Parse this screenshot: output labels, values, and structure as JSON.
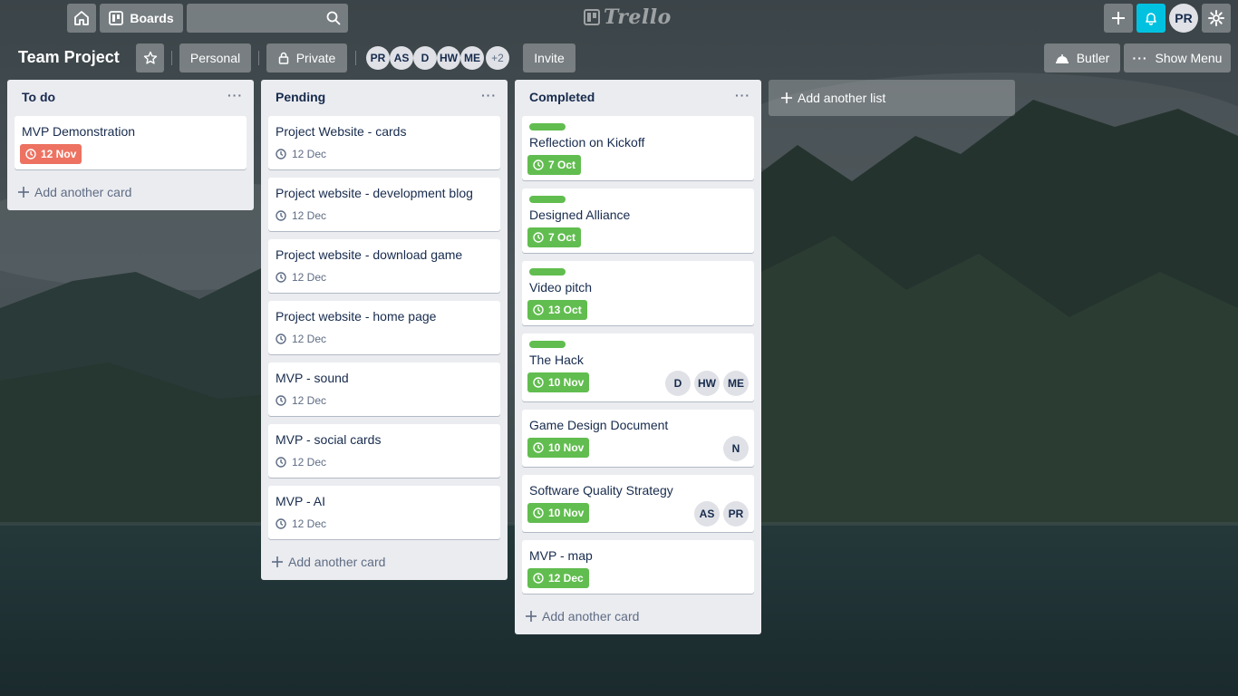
{
  "topbar": {
    "boards_label": "Boards",
    "search_placeholder": "",
    "logo_text": "Trello",
    "user_initials": "PR",
    "notification_color": "#00c2e0"
  },
  "board": {
    "title": "Team Project",
    "visibility_team": "Personal",
    "visibility_private": "Private",
    "members": [
      "PR",
      "AS",
      "D",
      "HW",
      "ME"
    ],
    "more_members": "+2",
    "invite_label": "Invite",
    "butler_label": "Butler",
    "menu_label": "Show Menu"
  },
  "colors": {
    "label_green": "#61bd4f",
    "due_overdue": "#eb5a46",
    "list_bg": "#ebecf0"
  },
  "lists": [
    {
      "title": "To do",
      "cards": [
        {
          "title": "MVP Demonstration",
          "due": "12 Nov",
          "due_style": "overdue"
        }
      ],
      "add_card_label": "Add another card"
    },
    {
      "title": "Pending",
      "cards": [
        {
          "title": "Project Website - cards",
          "due": "12 Dec"
        },
        {
          "title": "Project website - development blog",
          "due": "12 Dec"
        },
        {
          "title": "Project website - download game",
          "due": "12 Dec"
        },
        {
          "title": "Project website - home page",
          "due": "12 Dec"
        },
        {
          "title": "MVP - sound",
          "due": "12 Dec"
        },
        {
          "title": "MVP - social cards",
          "due": "12 Dec"
        },
        {
          "title": "MVP - AI",
          "due": "12 Dec"
        }
      ],
      "add_card_label": "Add another card"
    },
    {
      "title": "Completed",
      "cards": [
        {
          "title": "Reflection on Kickoff",
          "due": "7 Oct",
          "label": "green",
          "due_style": "complete"
        },
        {
          "title": "Designed Alliance",
          "due": "7 Oct",
          "label": "green",
          "due_style": "complete"
        },
        {
          "title": "Video pitch",
          "due": "13 Oct",
          "label": "green",
          "due_style": "complete"
        },
        {
          "title": "The Hack",
          "due": "10 Nov",
          "label": "green",
          "due_style": "complete",
          "members": [
            "D",
            "HW",
            "ME"
          ]
        },
        {
          "title": "Game Design Document",
          "due": "10 Nov",
          "due_style": "complete",
          "members": [
            "N"
          ]
        },
        {
          "title": "Software Quality Strategy",
          "due": "10 Nov",
          "due_style": "complete",
          "members": [
            "AS",
            "PR"
          ]
        },
        {
          "title": "MVP - map",
          "due": "12 Dec",
          "due_style": "complete"
        }
      ],
      "add_card_label": "Add another card"
    }
  ],
  "add_list_label": "Add another list"
}
